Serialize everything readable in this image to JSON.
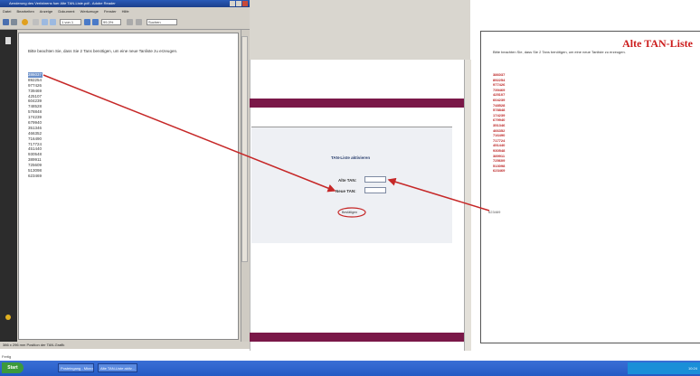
{
  "viewer": {
    "title": "Aenderung des Verfahrens fuer Alte TAN-Liste.pdf - Adobe Reader",
    "menu": [
      "Datei",
      "Bearbeiten",
      "Anzeige",
      "Dokument",
      "Werkzeuge",
      "Fenster",
      "Hilfe"
    ],
    "page_indicator": "1 von 1",
    "zoom": "99,3%",
    "search_placeholder": "Suchen",
    "doc_text": "Bitte beachten Sie, dass Sie 2 Tans benötigen, um eine neue Tanliste zu erzeugen.",
    "tans": [
      "386037",
      "892254",
      "977426",
      "739469",
      "425107",
      "604239",
      "748528",
      "578848",
      "174239",
      "679940",
      "351346",
      "466352",
      "716490",
      "717724",
      "451440",
      "930548",
      "389911",
      "725609",
      "513098",
      "623469"
    ],
    "status": "386 x 296 mm Position der TAN-Grafik"
  },
  "form": {
    "heading": "TAN-Liste aktivieren",
    "old_tan_label": "Alte TAN:",
    "new_tan_label": "Neue TAN:",
    "submit_label": "Bestätigen"
  },
  "right": {
    "title": "Alte TAN-Liste",
    "doc_text": "Bitte beachten Sie, dass Sie 2 Tans benötigen, um eine neue Tanliste zu erzeugen.",
    "tans": [
      "386037",
      "892254",
      "977426",
      "739469",
      "425107",
      "604239",
      "748528",
      "578848",
      "174239",
      "679940",
      "351346",
      "466352",
      "716490",
      "717724",
      "451440",
      "930548",
      "389911",
      "725609",
      "513098",
      "623469"
    ],
    "last_tan": "623469"
  },
  "browser_status": "Fertig",
  "taskbar": {
    "start_label": "Start",
    "tasks": [
      "Posteingang - Micros...",
      "Alte TAN-Liste aktiv..."
    ],
    "clock": "10:24"
  },
  "colors": {
    "accent_band": "#7a1848",
    "arrow": "#c62828",
    "title_red": "#cc1d1d"
  }
}
